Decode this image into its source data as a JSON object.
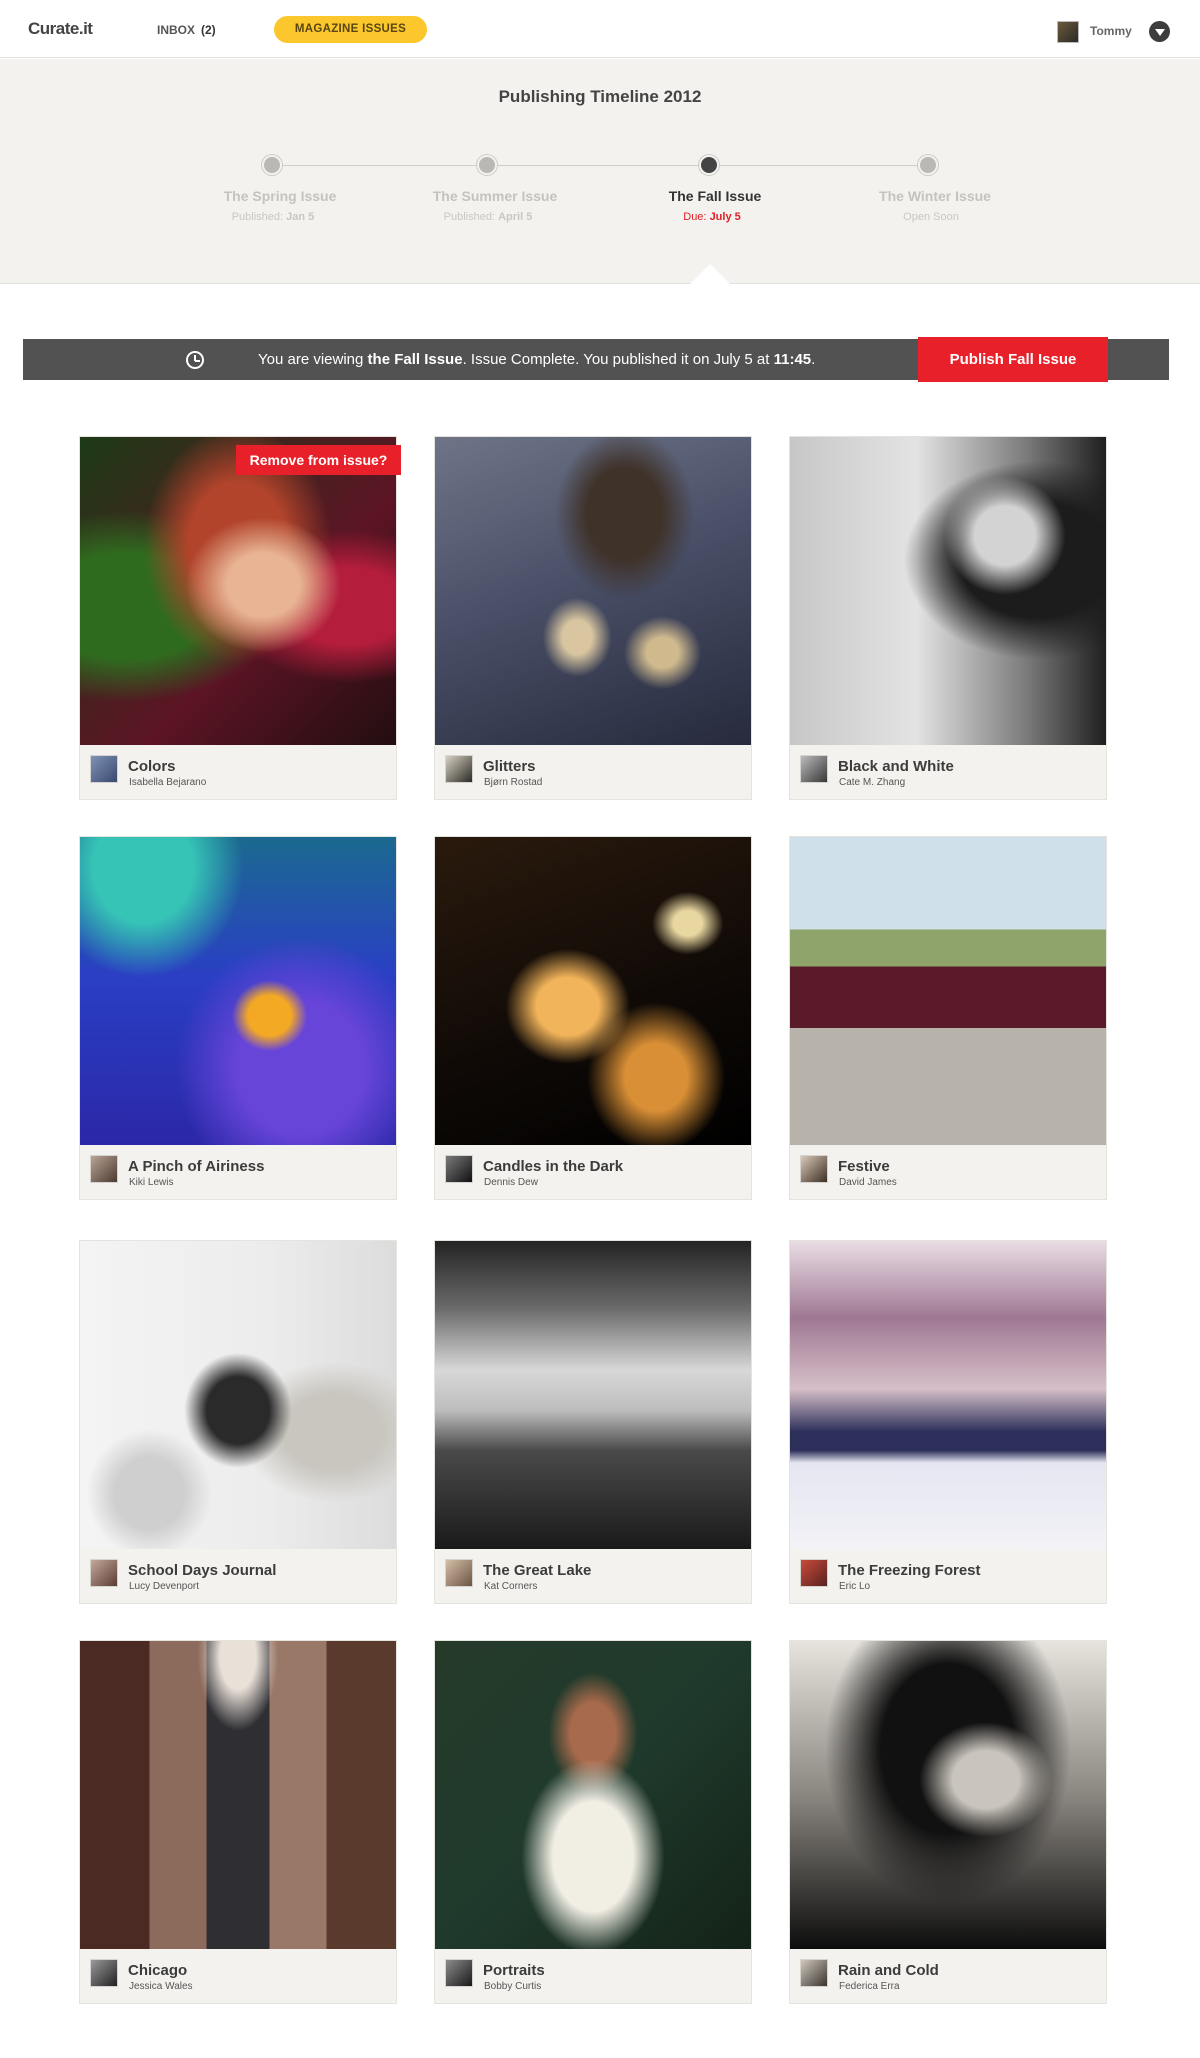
{
  "nav": {
    "brand": "Curate.it",
    "inbox_label": "INBOX",
    "inbox_count": "(2)",
    "magazine_label": "MAGAZINE ISSUES",
    "user_name": "Tommy"
  },
  "timeline": {
    "title": "Publishing Timeline 2012",
    "issues": [
      {
        "name": "The Spring Issue",
        "sub_prefix": "Published:",
        "sub_value": "Jan 5"
      },
      {
        "name": "The Summer Issue",
        "sub_prefix": "Published:",
        "sub_value": "April 5"
      },
      {
        "name": "The Fall Issue",
        "sub_prefix": "Due:",
        "sub_value": "July 5"
      },
      {
        "name": "The Winter Issue",
        "sub_prefix": "",
        "sub_value": "Open Soon"
      }
    ]
  },
  "status": {
    "p1": "You are viewing ",
    "issue": "the Fall Issue",
    "p2": ". Issue Complete. You published it on July 5 at ",
    "time": "11:45",
    "p3": ".",
    "publish_label": "Publish Fall Issue"
  },
  "remove_label": "Remove from issue?",
  "cards": [
    {
      "title": "Colors",
      "author": "Isabella Bejarano"
    },
    {
      "title": "Glitters",
      "author": "Bjørn Rostad"
    },
    {
      "title": "Black and White",
      "author": "Cate M. Zhang"
    },
    {
      "title": "A Pinch of Airiness",
      "author": "Kiki Lewis"
    },
    {
      "title": "Candles in the Dark",
      "author": "Dennis Dew"
    },
    {
      "title": "Festive",
      "author": "David James"
    },
    {
      "title": "School Days Journal",
      "author": "Lucy Devenport"
    },
    {
      "title": "The Great Lake",
      "author": "Kat Corners"
    },
    {
      "title": "The Freezing Forest",
      "author": "Eric Lo"
    },
    {
      "title": "Chicago",
      "author": "Jessica Wales"
    },
    {
      "title": "Portraits",
      "author": "Bobby Curtis"
    },
    {
      "title": "Rain and Cold",
      "author": "Federica Erra"
    }
  ],
  "colors": {
    "accent": "#fbc72d",
    "danger": "#e8202a",
    "bar": "#525252"
  }
}
